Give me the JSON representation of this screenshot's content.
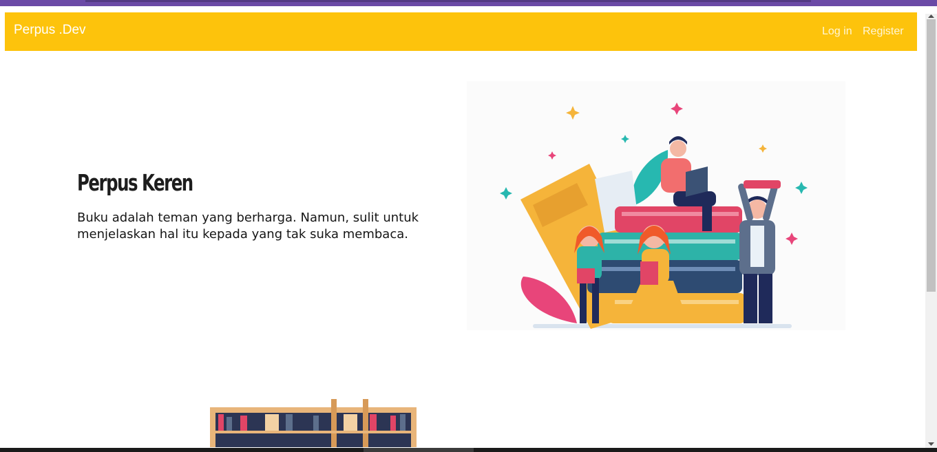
{
  "navbar": {
    "brand": "Perpus .Dev",
    "links": [
      {
        "label": "Log in"
      },
      {
        "label": "Register"
      }
    ],
    "background_color": "#fdc30c"
  },
  "hero": {
    "title": "Perpus Keren",
    "text": "Buku adalah teman yang berharga. Namun, sulit untuk menjelaskan hal itu kepada yang tak suka membaca."
  },
  "images": {
    "hero_illustration": "people-reading-stacked-books-illustration",
    "bookshelf": "bookshelf-illustration"
  }
}
